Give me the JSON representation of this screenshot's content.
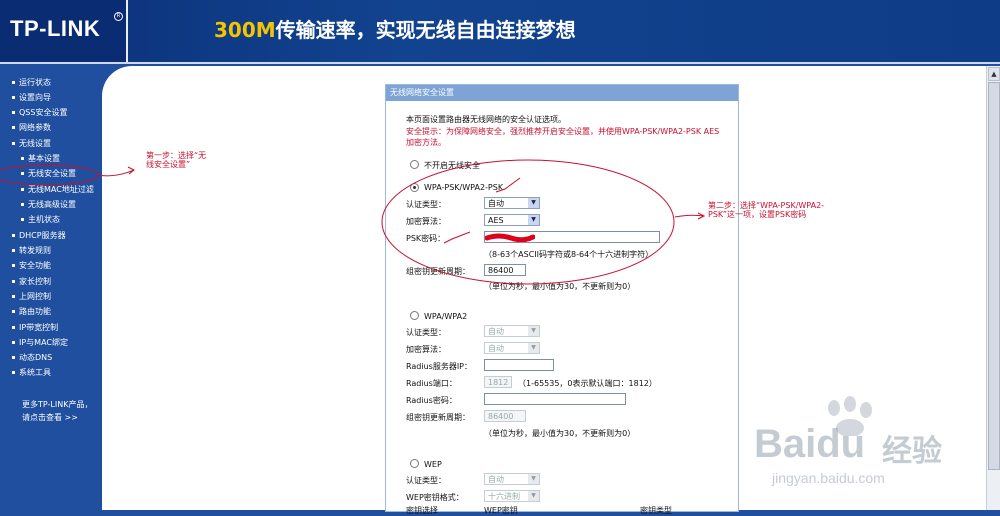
{
  "header": {
    "logo": "TP-LINK",
    "logo_mark": "R",
    "slogan_highlight": "300M",
    "slogan_rest": "传输速率，实现无线自由连接梦想"
  },
  "sidebar": {
    "items": [
      {
        "label": "运行状态"
      },
      {
        "label": "设置向导"
      },
      {
        "label": "QSS安全设置"
      },
      {
        "label": "网络参数"
      },
      {
        "label": "无线设置"
      },
      {
        "label": "基本设置"
      },
      {
        "label": "无线安全设置"
      },
      {
        "label": "无线MAC地址过滤"
      },
      {
        "label": "无线高级设置"
      },
      {
        "label": "主机状态"
      },
      {
        "label": "DHCP服务器"
      },
      {
        "label": "转发规则"
      },
      {
        "label": "安全功能"
      },
      {
        "label": "家长控制"
      },
      {
        "label": "上网控制"
      },
      {
        "label": "路由功能"
      },
      {
        "label": "IP带宽控制"
      },
      {
        "label": "IP与MAC绑定"
      },
      {
        "label": "动态DNS"
      },
      {
        "label": "系统工具"
      }
    ],
    "more_line1": "更多TP-LINK产品，",
    "more_line2": "请点击查看 >>"
  },
  "panel": {
    "title": "无线网络安全设置",
    "intro": "本页面设置路由器无线网络的安全认证选项。",
    "tip_line1": "安全提示：为保障网络安全，强烈推荐开启安全设置，并使用WPA-PSK/WPA2-PSK AES",
    "tip_line2": "加密方法。",
    "option_none": "不开启无线安全",
    "psk": {
      "label": "WPA-PSK/WPA2-PSK",
      "auth_label": "认证类型：",
      "auth_value": "自动",
      "enc_label": "加密算法：",
      "enc_value": "AES",
      "pwd_label": "PSK密码：",
      "pwd_hint": "（8-63个ASCII码字符或8-64个十六进制字符）",
      "renew_label": "组密钥更新周期：",
      "renew_value": "86400",
      "renew_hint": "（单位为秒，最小值为30，不更新则为0）"
    },
    "wpa": {
      "label": "WPA/WPA2",
      "auth_label": "认证类型：",
      "auth_value": "自动",
      "enc_label": "加密算法：",
      "enc_value": "自动",
      "radius_ip_label": "Radius服务器IP：",
      "radius_port_label": "Radius端口：",
      "radius_port_value": "1812",
      "radius_port_hint": "（1-65535，0表示默认端口：1812）",
      "radius_pwd_label": "Radius密码：",
      "renew_label": "组密钥更新周期：",
      "renew_value": "86400",
      "renew_hint": "（单位为秒，最小值为30，不更新则为0）"
    },
    "wep": {
      "label": "WEP",
      "auth_label": "认证类型：",
      "auth_value": "自动",
      "format_label": "WEP密钥格式：",
      "format_value": "十六进制",
      "col1": "密钥选择",
      "col2": "WEP密钥",
      "col3": "密钥类型"
    }
  },
  "annotations": {
    "step1_line1": "第一步：选择“无",
    "step1_line2": "线安全设置”",
    "step2_line1": "第二步：选择“WPA-PSK/WPA2-",
    "step2_line2": "PSK”这一项，设置PSK密码"
  },
  "watermark": {
    "brand": "Bai",
    "brand2": "du",
    "suffix": "经验",
    "url": "jingyan.baidu.com"
  },
  "colors": {
    "annotation": "#c8102e",
    "sidebar_bg": "#1f4f9e",
    "panel_title_bg": "#7ea3d6"
  }
}
